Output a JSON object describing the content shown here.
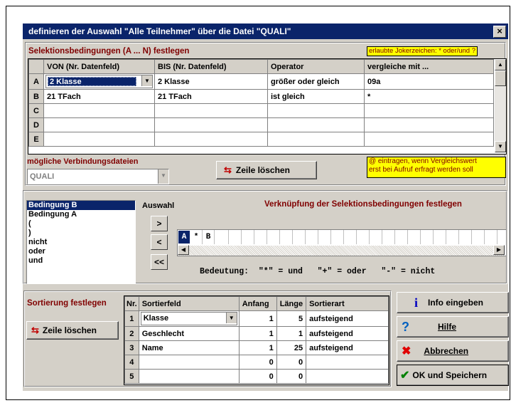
{
  "title": "definieren der Auswahl \"Alle Teilnehmer\" über die Datei \"QUALI\"",
  "close": "×",
  "selection": {
    "heading": "Selektionsbedingungen (A ... N) festlegen",
    "joker_hint": "erlaubte Jokerzeichen: * oder/und ?",
    "columns": [
      "VON  (Nr. Datenfeld)",
      "BIS  (Nr. Datenfeld)",
      "Operator",
      "vergleiche mit ..."
    ],
    "rows": [
      {
        "label": "A",
        "von": "2  Klasse",
        "bis": "2  Klasse",
        "operator": "größer oder gleich",
        "vergleich": "09a"
      },
      {
        "label": "B",
        "von": "21  TFach",
        "bis": "21  TFach",
        "operator": "ist gleich",
        "vergleich": "*"
      },
      {
        "label": "C",
        "von": "",
        "bis": "",
        "operator": "",
        "vergleich": ""
      },
      {
        "label": "D",
        "von": "",
        "bis": "",
        "operator": "",
        "vergleich": ""
      },
      {
        "label": "E",
        "von": "",
        "bis": "",
        "operator": "",
        "vergleich": ""
      }
    ],
    "connections_label": "mögliche Verbindungsdateien",
    "connection_value": "QUALI",
    "delete_row": "Zeile löschen",
    "at_hint_1": "@ eintragen, wenn Vergleichswert",
    "at_hint_2": "erst bei Aufruf erfragt werden soll"
  },
  "linking": {
    "list": [
      "Bedingung B",
      "Bedingung A",
      "(",
      ")",
      "nicht",
      "oder",
      "und"
    ],
    "auswahl": "Auswahl",
    "heading": "Verknüpfung der Selektionsbedingungen festlegen",
    "btn_add": ">",
    "btn_remove": "<",
    "btn_clear": "<<",
    "tokens": [
      "A",
      "*",
      "B"
    ],
    "legend": "Bedeutung:  \"*\" = und   \"+\" = oder   \"-\" = nicht"
  },
  "sort": {
    "heading": "Sortierung festlegen",
    "delete_row": "Zeile löschen",
    "columns": [
      "Nr.",
      "Sortierfeld",
      "Anfang",
      "Länge",
      "Sortierart"
    ],
    "rows": [
      {
        "nr": "1",
        "feld": "Klasse",
        "anfang": "1",
        "laenge": "5",
        "art": "aufsteigend"
      },
      {
        "nr": "2",
        "feld": "Geschlecht",
        "anfang": "1",
        "laenge": "1",
        "art": "aufsteigend"
      },
      {
        "nr": "3",
        "feld": "Name",
        "anfang": "1",
        "laenge": "25",
        "art": "aufsteigend"
      },
      {
        "nr": "4",
        "feld": "",
        "anfang": "0",
        "laenge": "0",
        "art": ""
      },
      {
        "nr": "5",
        "feld": "",
        "anfang": "0",
        "laenge": "0",
        "art": ""
      }
    ]
  },
  "buttons": {
    "info": "Info eingeben",
    "help": "Hilfe",
    "cancel": "Abbrechen",
    "ok": "OK und Speichern"
  },
  "colors": {
    "titlebar": "#0a246a",
    "accent_text": "#800000",
    "hint_bg": "#ffff00"
  }
}
